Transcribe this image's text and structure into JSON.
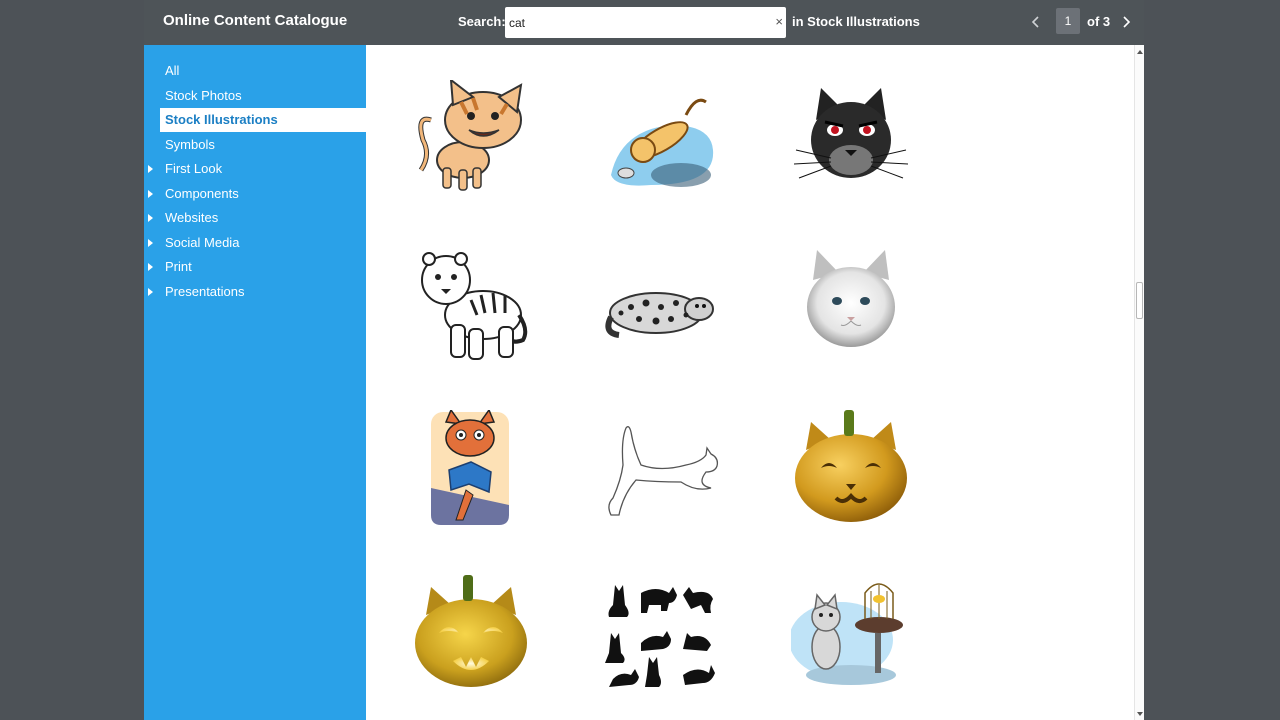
{
  "header": {
    "app_title": "Online Content Catalogue",
    "search_label": "Search:",
    "search_value": "cat",
    "search_clear": "×",
    "scope_text": "in Stock Illustrations",
    "pager": {
      "current_page": "1",
      "of_text": "of 3"
    }
  },
  "sidebar": {
    "items": [
      {
        "label": "All",
        "expandable": false,
        "active": false
      },
      {
        "label": "Stock Photos",
        "expandable": false,
        "active": false
      },
      {
        "label": "Stock Illustrations",
        "expandable": false,
        "active": true
      },
      {
        "label": "Symbols",
        "expandable": false,
        "active": false
      },
      {
        "label": "First Look",
        "expandable": true,
        "active": false
      },
      {
        "label": "Components",
        "expandable": true,
        "active": false
      },
      {
        "label": "Websites",
        "expandable": true,
        "active": false
      },
      {
        "label": "Social Media",
        "expandable": true,
        "active": false
      },
      {
        "label": "Print",
        "expandable": true,
        "active": false
      },
      {
        "label": "Presentations",
        "expandable": true,
        "active": false
      }
    ]
  },
  "results": {
    "thumbnails": [
      "cartoon-striped-cat-illustration",
      "cat-sliding-on-blue-splash-illustration",
      "angry-black-cat-face-illustration",
      "tiger-line-art-illustration",
      "snow-leopard-sketch-illustration",
      "white-fluffy-cat-face-illustration",
      "cat-reading-book-illustration",
      "leaping-cat-outline-illustration",
      "cat-jack-o-lantern-illustration",
      "glowing-cat-pumpkin-illustration",
      "black-cat-silhouettes-illustration",
      "cat-and-birdcage-illustration"
    ]
  },
  "colors": {
    "sidebar": "#2aa1e8",
    "topbar": "#4e5458",
    "backdrop": "#4d5257",
    "active_item_text": "#1b7fc4"
  }
}
